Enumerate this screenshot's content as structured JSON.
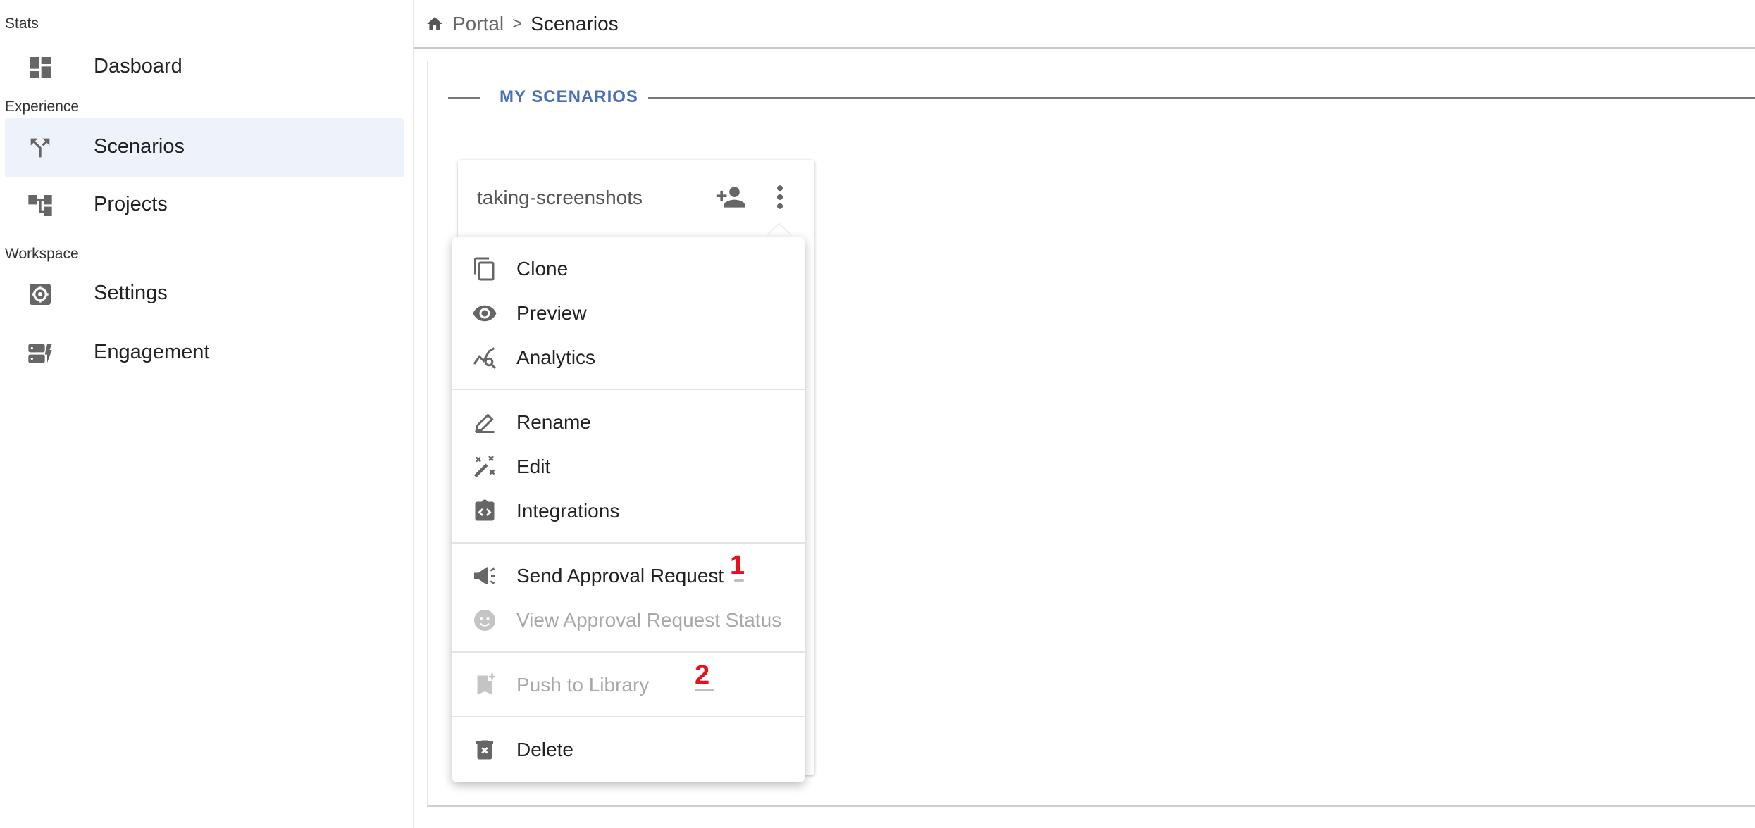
{
  "sidebar": {
    "sections": [
      {
        "label": "Stats"
      },
      {
        "label": "Experience"
      },
      {
        "label": "Workspace"
      }
    ],
    "items": [
      {
        "label": "Dasboard",
        "icon": "dashboard-icon"
      },
      {
        "label": "Scenarios",
        "icon": "fork-icon",
        "active": true
      },
      {
        "label": "Projects",
        "icon": "tree-icon"
      },
      {
        "label": "Settings",
        "icon": "gear-icon"
      },
      {
        "label": "Engagement",
        "icon": "engagement-icon"
      }
    ]
  },
  "breadcrumb": {
    "home_icon": "home-icon",
    "portal": "Portal",
    "separator": ">",
    "current": "Scenarios"
  },
  "main": {
    "section_title": "MY SCENARIOS",
    "card": {
      "title": "taking-screenshots",
      "add_user_icon": "person-add-icon",
      "more_icon": "more-vertical-icon"
    }
  },
  "menu": {
    "groups": [
      [
        {
          "label": "Clone",
          "icon": "copy-icon",
          "disabled": false
        },
        {
          "label": "Preview",
          "icon": "eye-icon",
          "disabled": false
        },
        {
          "label": "Analytics",
          "icon": "analytics-icon",
          "disabled": false
        }
      ],
      [
        {
          "label": "Rename",
          "icon": "pencil-icon",
          "disabled": false
        },
        {
          "label": "Edit",
          "icon": "magic-wand-icon",
          "disabled": false
        },
        {
          "label": "Integrations",
          "icon": "code-badge-icon",
          "disabled": false
        }
      ],
      [
        {
          "label": "Send Approval Request",
          "icon": "megaphone-icon",
          "disabled": false
        },
        {
          "label": "View Approval Request Status",
          "icon": "face-icon",
          "disabled": true
        }
      ],
      [
        {
          "label": "Push to Library",
          "icon": "bookmark-add-icon",
          "disabled": true
        }
      ],
      [
        {
          "label": "Delete",
          "icon": "trash-icon",
          "disabled": false
        }
      ]
    ]
  },
  "annotations": [
    {
      "label": "1"
    },
    {
      "label": "2"
    }
  ],
  "colors": {
    "accent": "#4a6fb8",
    "active_bg": "#eef2fb",
    "annotation": "#e8101e",
    "icon": "#666666"
  }
}
